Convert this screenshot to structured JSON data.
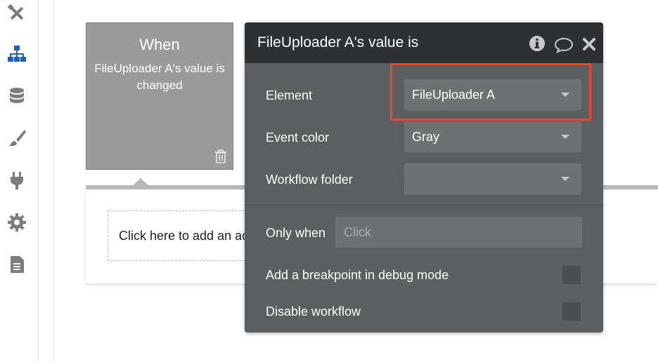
{
  "sidebar": {
    "items": [
      {
        "icon": "design-tools-icon"
      },
      {
        "icon": "workflow-icon",
        "active": true
      },
      {
        "icon": "database-icon"
      },
      {
        "icon": "paintbrush-icon"
      },
      {
        "icon": "plugin-icon"
      },
      {
        "icon": "gear-icon"
      },
      {
        "icon": "document-icon"
      }
    ]
  },
  "event_card": {
    "title": "When",
    "description": "FileUploader A's value is changed",
    "delete_icon": "trash-icon"
  },
  "action_area": {
    "add_action_text": "Click here to add an action..."
  },
  "editor": {
    "title": "FileUploader A's value is",
    "header_icons": [
      "info-icon",
      "comment-icon",
      "close-icon"
    ],
    "element": {
      "label": "Element",
      "value": "FileUploader A"
    },
    "event_color": {
      "label": "Event color",
      "value": "Gray"
    },
    "workflow_folder": {
      "label": "Workflow folder",
      "value": ""
    },
    "only_when": {
      "label": "Only when",
      "placeholder": "Click"
    },
    "breakpoint": {
      "label": "Add a breakpoint in debug mode",
      "checked": false
    },
    "disable": {
      "label": "Disable workflow",
      "checked": false
    }
  },
  "colors": {
    "highlight": "#e84a2f",
    "editor_bg": "#5c5e60",
    "editor_header": "#2e3133",
    "active_nav": "#1d63b8",
    "event_card": "#9b9b9b"
  }
}
